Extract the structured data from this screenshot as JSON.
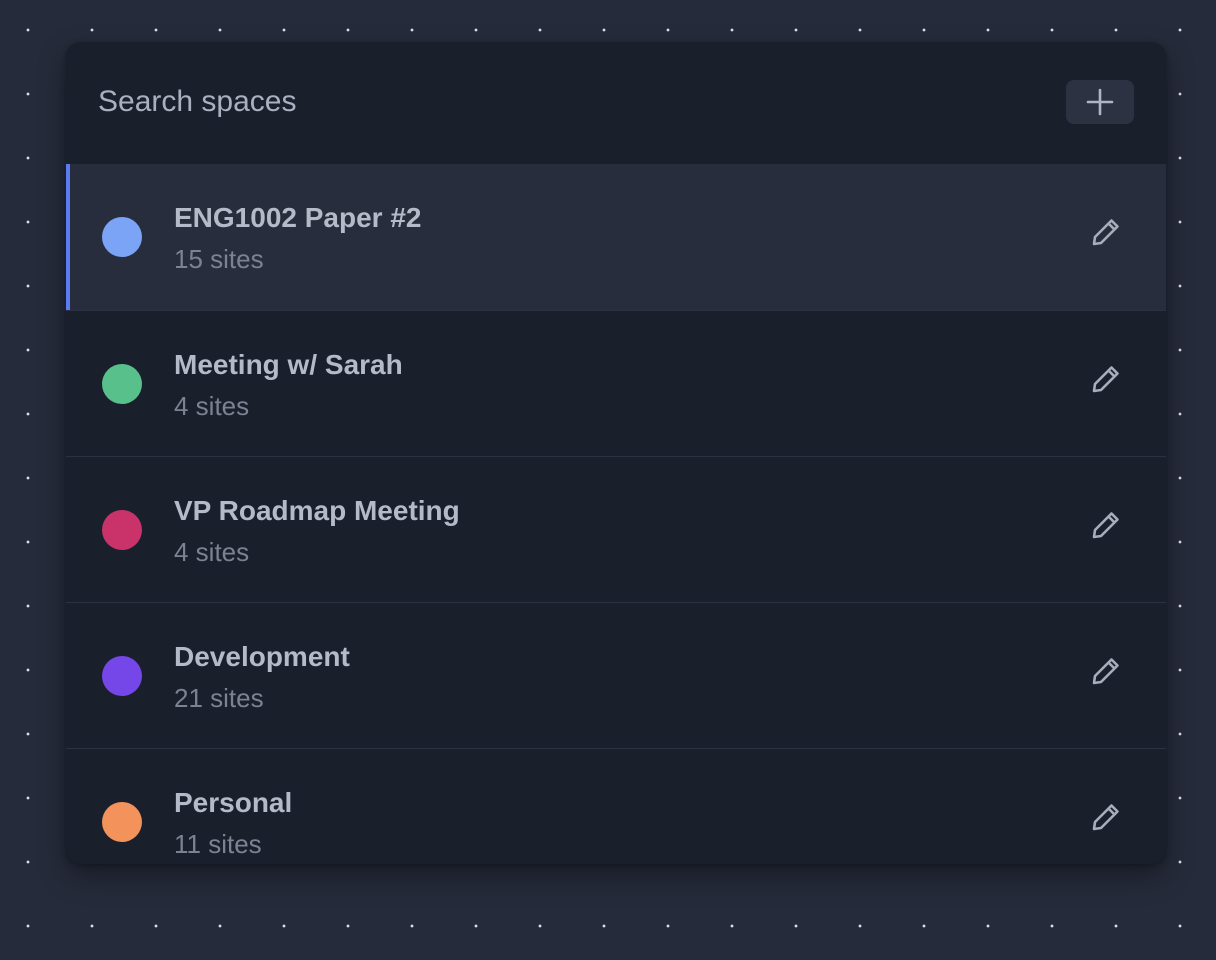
{
  "search": {
    "placeholder": "Search spaces",
    "value": ""
  },
  "add_button": {
    "icon": "plus-icon"
  },
  "spaces": [
    {
      "name": "ENG1002 Paper #2",
      "count": "15 sites",
      "color": "#7ba4f7",
      "active": true
    },
    {
      "name": "Meeting w/ Sarah",
      "count": "4 sites",
      "color": "#57c08b",
      "active": false
    },
    {
      "name": "VP Roadmap Meeting",
      "count": "4 sites",
      "color": "#c9336a",
      "active": false
    },
    {
      "name": "Development",
      "count": "21 sites",
      "color": "#7546e8",
      "active": false
    },
    {
      "name": "Personal",
      "count": "11 sites",
      "color": "#f3925a",
      "active": false
    }
  ],
  "edit_icon": "pencil-icon",
  "colors": {
    "background": "#262b3b",
    "panel": "#1a1f2c",
    "active_row": "#272d3c",
    "active_accent": "#5b7cf0"
  }
}
